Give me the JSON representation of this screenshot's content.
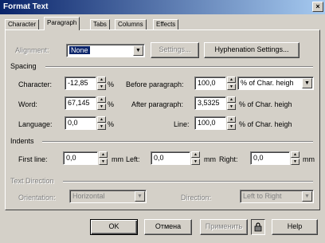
{
  "window": {
    "title": "Format Text",
    "close_label": "×"
  },
  "tabs": [
    {
      "label": "Character"
    },
    {
      "label": "Paragraph"
    },
    {
      "label": "Tabs"
    },
    {
      "label": "Columns"
    },
    {
      "label": "Effects"
    }
  ],
  "alignment": {
    "label": "Alignment:",
    "value": "None",
    "settings_label": "Settings...",
    "hyphenation_label": "Hyphenation Settings..."
  },
  "spacing": {
    "section": "Spacing",
    "character": {
      "label": "Character:",
      "value": "-12,85",
      "unit": "%"
    },
    "word": {
      "label": "Word:",
      "value": "67,145",
      "unit": "%"
    },
    "language": {
      "label": "Language:",
      "value": "0,0",
      "unit": "%"
    },
    "before": {
      "label": "Before paragraph:",
      "value": "100,0",
      "unit": "% of Char. heigh"
    },
    "after": {
      "label": "After paragraph:",
      "value": "3,5325",
      "unit": "% of Char. heigh"
    },
    "line": {
      "label": "Line:",
      "value": "100,0",
      "unit": "% of Char. heigh"
    }
  },
  "indents": {
    "section": "Indents",
    "first_line": {
      "label": "First line:",
      "value": "0,0",
      "unit": "mm"
    },
    "left": {
      "label": "Left:",
      "value": "0,0",
      "unit": "mm"
    },
    "right": {
      "label": "Right:",
      "value": "0,0",
      "unit": "mm"
    }
  },
  "text_direction": {
    "section": "Text Direction",
    "orientation": {
      "label": "Orientation:",
      "value": "Horizontal"
    },
    "direction": {
      "label": "Direction:",
      "value": "Left to Right"
    }
  },
  "buttons": {
    "ok": "OK",
    "cancel": "Отмена",
    "apply": "Применить",
    "help": "Help"
  },
  "icons": {
    "lock": "lock-icon"
  }
}
